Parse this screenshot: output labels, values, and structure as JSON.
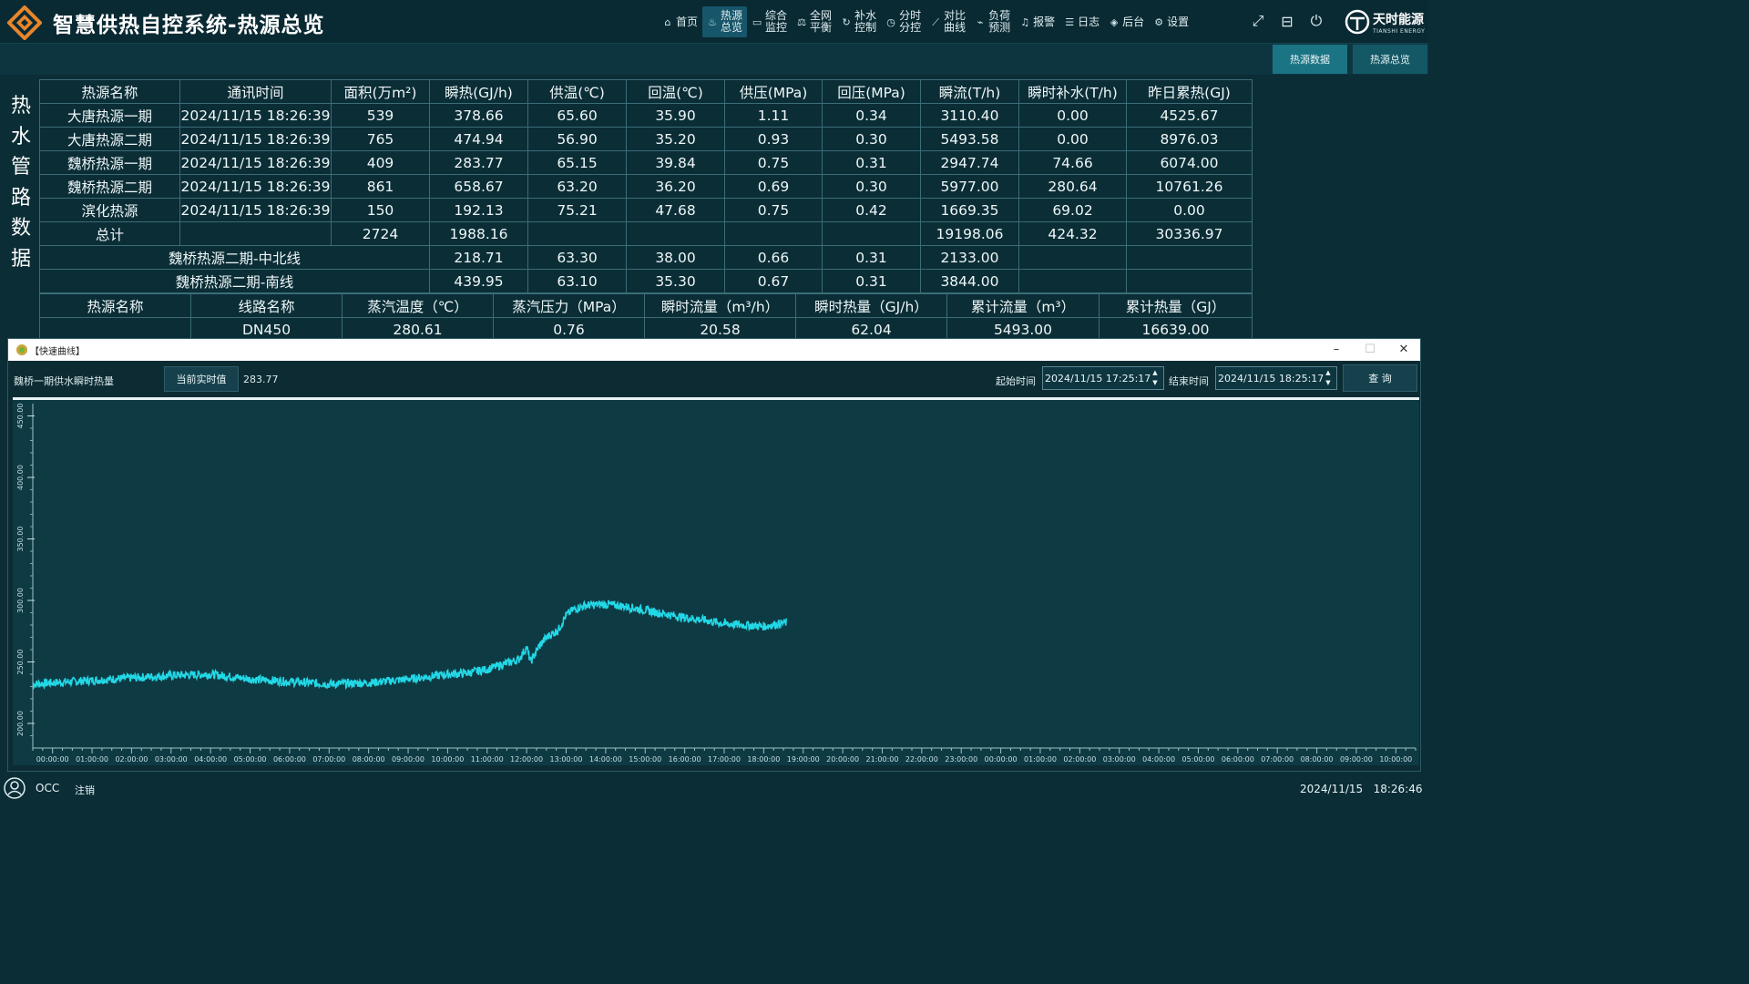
{
  "header": {
    "title": "智慧供热自控系统-热源总览",
    "nav": [
      {
        "label": "首页",
        "icon": "home-icon"
      },
      {
        "label": "热源\n总览",
        "icon": "flame-icon",
        "active": true
      },
      {
        "label": "综合\n监控",
        "icon": "monitor-icon"
      },
      {
        "label": "全网\n平衡",
        "icon": "balance-icon"
      },
      {
        "label": "补水\n控制",
        "icon": "refresh-icon"
      },
      {
        "label": "分时\n分控",
        "icon": "clock-box-icon"
      },
      {
        "label": "对比\n曲线",
        "icon": "line-chart-icon"
      },
      {
        "label": "负荷\n预测",
        "icon": "forecast-icon"
      },
      {
        "label": "报警",
        "icon": "bell-icon"
      },
      {
        "label": "日志",
        "icon": "log-icon"
      },
      {
        "label": "后台",
        "icon": "layers-icon"
      },
      {
        "label": "设置",
        "icon": "gear-icon"
      }
    ],
    "brand_name": "天时能源",
    "brand_sub": "TIANSHI ENERGY"
  },
  "subtabs": [
    {
      "label": "热源数据",
      "active": true
    },
    {
      "label": "热源总览",
      "active": false
    }
  ],
  "side_label": "热水管路数据",
  "table1": {
    "headers": [
      "热源名称",
      "通讯时间",
      "面积(万m²)",
      "瞬热(GJ/h)",
      "供温(℃)",
      "回温(℃)",
      "供压(MPa)",
      "回压(MPa)",
      "瞬流(T/h)",
      "瞬时补水(T/h)",
      "昨日累热(GJ)"
    ],
    "rows": [
      [
        "大唐热源一期",
        "2024/11/15 18:26:39",
        "539",
        "378.66",
        "65.60",
        "35.90",
        "1.11",
        "0.34",
        "3110.40",
        "0.00",
        "4525.67"
      ],
      [
        "大唐热源二期",
        "2024/11/15 18:26:39",
        "765",
        "474.94",
        "56.90",
        "35.20",
        "0.93",
        "0.30",
        "5493.58",
        "0.00",
        "8976.03"
      ],
      [
        "魏桥热源一期",
        "2024/11/15 18:26:39",
        "409",
        "283.77",
        "65.15",
        "39.84",
        "0.75",
        "0.31",
        "2947.74",
        "74.66",
        "6074.00"
      ],
      [
        "魏桥热源二期",
        "2024/11/15 18:26:39",
        "861",
        "658.67",
        "63.20",
        "36.20",
        "0.69",
        "0.30",
        "5977.00",
        "280.64",
        "10761.26"
      ],
      [
        "滨化热源",
        "2024/11/15 18:26:39",
        "150",
        "192.13",
        "75.21",
        "47.68",
        "0.75",
        "0.42",
        "1669.35",
        "69.02",
        "0.00"
      ]
    ],
    "total": [
      "总计",
      "",
      "2724",
      "1988.16",
      "",
      "",
      "",
      "",
      "19198.06",
      "424.32",
      "30336.97"
    ],
    "lines": [
      [
        "魏桥热源二期-中北线",
        "218.71",
        "63.30",
        "38.00",
        "0.66",
        "0.31",
        "2133.00",
        "",
        ""
      ],
      [
        "魏桥热源二期-南线",
        "439.95",
        "63.10",
        "35.30",
        "0.67",
        "0.31",
        "3844.00",
        "",
        ""
      ]
    ]
  },
  "table2": {
    "headers": [
      "热源名称",
      "线路名称",
      "蒸汽温度（℃）",
      "蒸汽压力（MPa）",
      "瞬时流量（m³/h）",
      "瞬时热量（GJ/h）",
      "累计流量（m³）",
      "累计热量（GJ）"
    ],
    "rows": [
      [
        "",
        "DN450",
        "280.61",
        "0.76",
        "20.58",
        "62.04",
        "5493.00",
        "16639.00"
      ]
    ]
  },
  "popup": {
    "title": "【快速曲线】",
    "series_label": "魏桥一期供水瞬时热量",
    "current_btn": "当前实时值",
    "current_value": "283.77",
    "start_label": "起始时间",
    "start_value": "2024/11/15 17:25:17",
    "end_label": "结束时间",
    "end_value": "2024/11/15 18:25:17",
    "query_btn": "查 询"
  },
  "chart_data": {
    "type": "line",
    "ylim": [
      180,
      460
    ],
    "yticks": [
      200,
      250,
      300,
      350,
      400,
      450
    ],
    "ytick_labels": [
      "200.00",
      "250.00",
      "300.00",
      "350.00",
      "400.00",
      "450.00"
    ],
    "xticks": [
      "00:00:00",
      "01:00:00",
      "02:00:00",
      "03:00:00",
      "04:00:00",
      "05:00:00",
      "06:00:00",
      "07:00:00",
      "08:00:00",
      "09:00:00",
      "10:00:00",
      "11:00:00",
      "12:00:00",
      "13:00:00",
      "14:00:00",
      "15:00:00",
      "16:00:00",
      "17:00:00",
      "18:00:00",
      "19:00:00",
      "20:00:00",
      "21:00:00",
      "22:00:00",
      "23:00:00",
      "00:00:00",
      "01:00:00",
      "02:00:00",
      "03:00:00",
      "04:00:00",
      "05:00:00",
      "06:00:00",
      "07:00:00",
      "08:00:00",
      "09:00:00",
      "10:00:00"
    ],
    "xlim_hours": [
      -0.5,
      34.5
    ],
    "series": [
      {
        "color": "#22d8e6",
        "x": [
          -0.5,
          0.5,
          1.0,
          1.5,
          2.0,
          3.0,
          4.0,
          5.0,
          6.0,
          7.0,
          8.0,
          9.0,
          10.0,
          10.5,
          11.0,
          11.5,
          11.8,
          12.0,
          12.1,
          12.3,
          12.5,
          12.8,
          13.0,
          13.2,
          13.5,
          14.0,
          14.5,
          15.0,
          15.5,
          16.0,
          16.5,
          17.0,
          17.5,
          18.0,
          18.6
        ],
        "y": [
          232,
          234,
          235,
          236,
          237,
          239,
          240,
          236,
          234,
          232,
          233,
          236,
          240,
          241,
          244,
          249,
          252,
          262,
          250,
          262,
          270,
          276,
          288,
          293,
          296,
          297,
          295,
          292,
          289,
          286,
          284,
          281,
          280,
          279,
          282
        ]
      }
    ]
  },
  "status": {
    "user": "OCC",
    "logout": "注销",
    "datetime": "2024/11/15   18:26:46"
  }
}
